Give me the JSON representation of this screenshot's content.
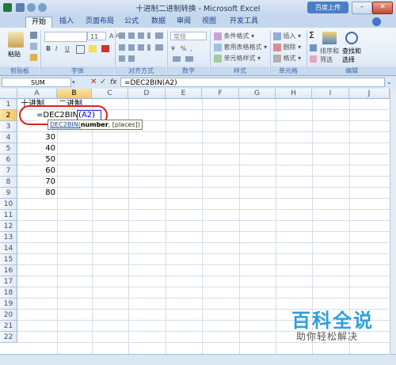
{
  "window": {
    "title": "十进制二进制转换 - Microsoft Excel",
    "upload_label": "百度上传"
  },
  "tabs": [
    "开始",
    "插入",
    "页面布局",
    "公式",
    "数据",
    "审阅",
    "视图",
    "开发工具"
  ],
  "ribbon": {
    "clipboard": {
      "paste_label": "粘贴",
      "group_label": "剪贴板"
    },
    "font": {
      "size": "11",
      "grow": "A",
      "shrink": "A",
      "bold": "B",
      "italic": "I",
      "underline": "U",
      "group_label": "字体"
    },
    "alignment": {
      "group_label": "对齐方式"
    },
    "number": {
      "format": "常规",
      "percent": "%",
      "comma": ",",
      "group_label": "数字"
    },
    "styles": {
      "items": [
        "条件格式",
        "套用表格格式",
        "单元格样式"
      ],
      "group_label": "样式"
    },
    "cells": {
      "items": [
        "插入",
        "删除",
        "格式"
      ],
      "group_label": "单元格"
    },
    "editing": {
      "sigma": "Σ",
      "sort_label_1": "排序和",
      "sort_label_2": "筛选",
      "find_label_1": "查找和",
      "find_label_2": "选择",
      "group_label": "编辑"
    }
  },
  "formula_bar": {
    "name_box": "SUM",
    "fx": "fx",
    "formula": "=DEC2BIN(A2)"
  },
  "grid": {
    "columns": [
      "A",
      "B",
      "C",
      "D",
      "E",
      "F",
      "G",
      "H",
      "I",
      "J"
    ],
    "rows": [
      "1",
      "2",
      "3",
      "4",
      "5",
      "6",
      "7",
      "8",
      "9",
      "10",
      "11",
      "12",
      "13",
      "14",
      "15",
      "16",
      "17",
      "18",
      "19",
      "20",
      "21",
      "22"
    ],
    "header_a1": "十进制",
    "header_b1": "二进制",
    "editing_prefix": "=DEC2BIN(",
    "editing_ref": "A2",
    "editing_suffix": ")",
    "tooltip_fn": "DEC2BIN(",
    "tooltip_arg": "number",
    "tooltip_rest": ", [places])",
    "a_values": [
      "30",
      "40",
      "50",
      "60",
      "70",
      "80"
    ]
  },
  "watermark": {
    "title": "百科全说",
    "subtitle": "助你轻松解决"
  },
  "colors": {
    "accent": "#1e4e8c",
    "ref_blue": "#0000ff",
    "circle_red": "#e02020"
  }
}
